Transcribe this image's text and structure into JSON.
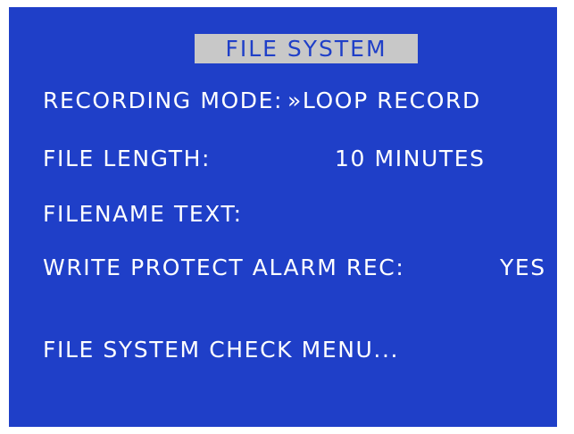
{
  "menu": {
    "title": "FILE SYSTEM",
    "items": [
      {
        "label": "RECORDING MODE:",
        "value": "»LOOP RECORD"
      },
      {
        "label": "FILE LENGTH:",
        "value": "10 MINUTES"
      },
      {
        "label": "FILENAME TEXT:",
        "value": ""
      },
      {
        "label": "WRITE PROTECT ALARM REC:",
        "value": "YES"
      },
      {
        "label": "FILE SYSTEM CHECK MENU...",
        "value": ""
      }
    ]
  },
  "colors": {
    "background": "#1f3fc8",
    "title_highlight": "#c8c8c8",
    "text": "#ffffff"
  }
}
